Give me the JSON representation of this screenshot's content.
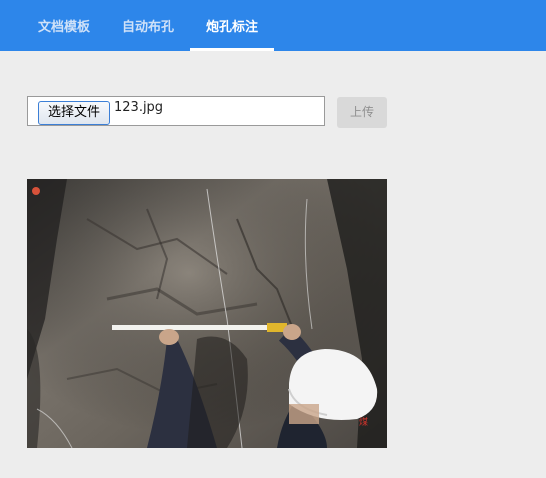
{
  "nav": {
    "tabs": [
      {
        "label": "文档模板",
        "active": false
      },
      {
        "label": "自动布孔",
        "active": false
      },
      {
        "label": "炮孔标注",
        "active": true
      }
    ],
    "accent_color": "#2d86ea"
  },
  "upload": {
    "choose_label": "选择文件",
    "file_name": "123.jpg",
    "submit_label": "上传"
  },
  "photo": {
    "icon": "tunnel-face-photo-image"
  }
}
